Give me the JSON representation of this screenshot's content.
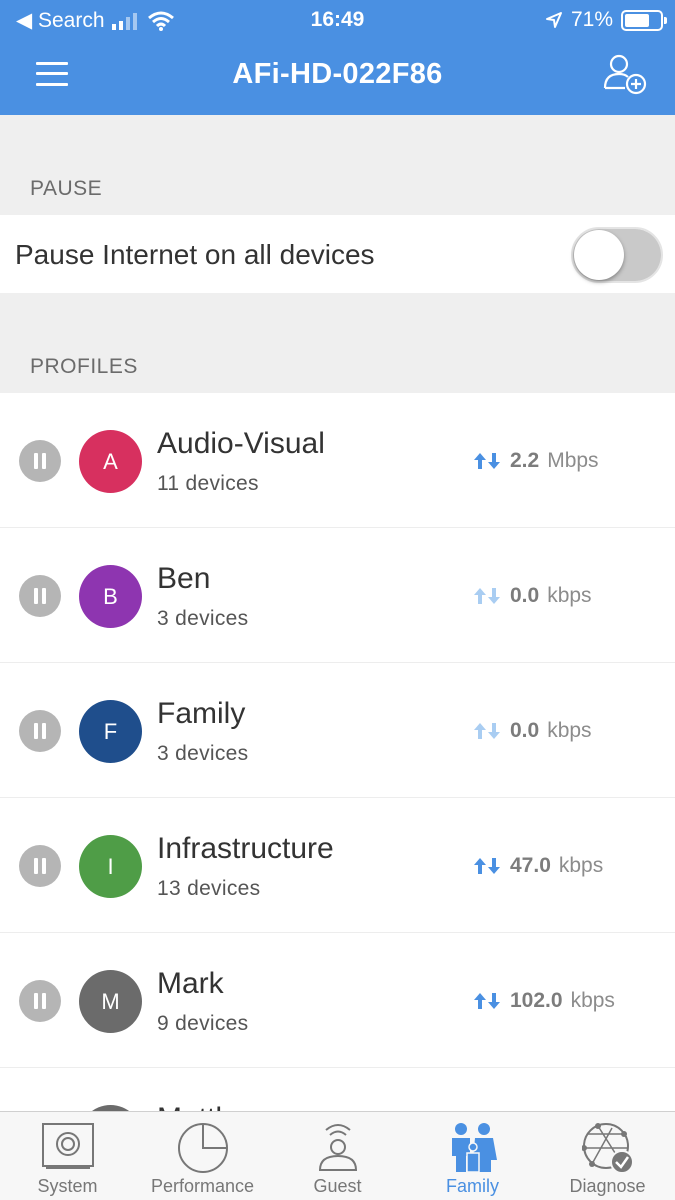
{
  "status_bar": {
    "back_label": "◀ Search",
    "time": "16:49",
    "battery": "71%",
    "battery_level": 0.71
  },
  "header": {
    "title": "AFi-HD-022F86",
    "menu_icon": "hamburger-icon",
    "add_icon": "add-user-icon"
  },
  "pause_section": {
    "label": "PAUSE",
    "row_label": "Pause Internet on all devices",
    "toggle_on": false
  },
  "profiles_section": {
    "label": "PROFILES",
    "items": [
      {
        "initial": "A",
        "name": "Audio-Visual",
        "devices": "11 devices",
        "rate_value": "2.2",
        "rate_unit": "Mbps",
        "color": "#d7305f",
        "active": true
      },
      {
        "initial": "B",
        "name": "Ben",
        "devices": "3 devices",
        "rate_value": "0.0",
        "rate_unit": "kbps",
        "color": "#8e35b0",
        "active": false
      },
      {
        "initial": "F",
        "name": "Family",
        "devices": "3 devices",
        "rate_value": "0.0",
        "rate_unit": "kbps",
        "color": "#1f4e8c",
        "active": false
      },
      {
        "initial": "I",
        "name": "Infrastructure",
        "devices": "13 devices",
        "rate_value": "47.0",
        "rate_unit": "kbps",
        "color": "#4f9d47",
        "active": true
      },
      {
        "initial": "M",
        "name": "Mark",
        "devices": "9 devices",
        "rate_value": "102.0",
        "rate_unit": "kbps",
        "color": "#6b6b6b",
        "active": true
      },
      {
        "initial": "",
        "name": "Matth",
        "devices": "",
        "rate_value": "",
        "rate_unit": "",
        "color": "#6b6b6b",
        "active": false
      }
    ]
  },
  "tabbar": {
    "tabs": [
      {
        "label": "System",
        "icon": "system-icon",
        "active": false
      },
      {
        "label": "Performance",
        "icon": "performance-icon",
        "active": false
      },
      {
        "label": "Guest",
        "icon": "guest-icon",
        "active": false
      },
      {
        "label": "Family",
        "icon": "family-icon",
        "active": true
      },
      {
        "label": "Diagnose",
        "icon": "diagnose-icon",
        "active": false
      }
    ]
  },
  "colors": {
    "brand": "#4a90e2",
    "arrow_active": "#4a90e2",
    "arrow_inactive": "#a9cdf2"
  }
}
